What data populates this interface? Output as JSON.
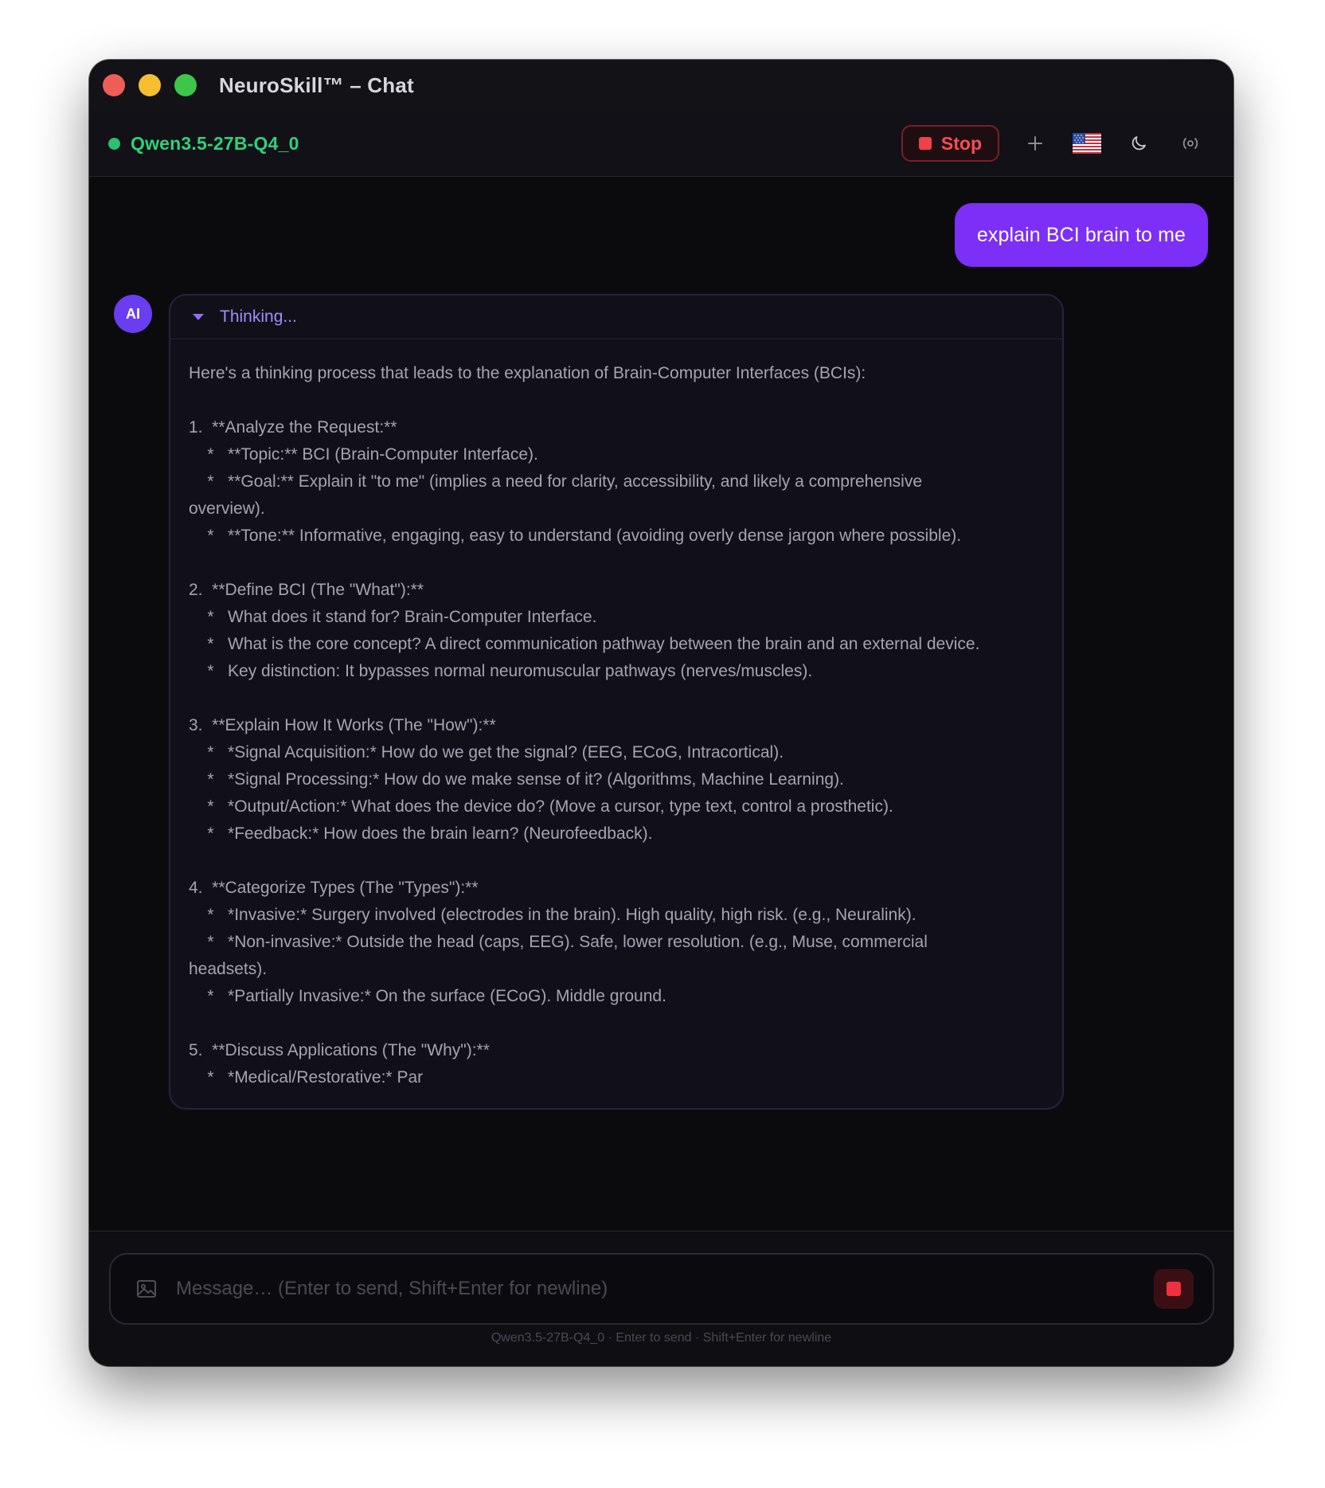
{
  "window": {
    "title": "NeuroSkill™ – Chat"
  },
  "toolbar": {
    "model_name": "Qwen3.5-27B-Q4_0",
    "stop_label": "Stop",
    "flag_icon": "us-flag-icon",
    "theme_icon": "moon-icon",
    "broadcast_icon": "broadcast-icon",
    "new_chat_icon": "plus-icon"
  },
  "chat": {
    "user_message": "explain BCI brain to me",
    "ai_avatar_label": "AI",
    "thinking_label": "Thinking...",
    "thinking_lines": [
      "Here's a thinking process that leads to the explanation of Brain-Computer Interfaces (BCIs):",
      "",
      "1.  **Analyze the Request:**",
      "    *   **Topic:** BCI (Brain-Computer Interface).",
      "    *   **Goal:** Explain it \"to me\" (implies a need for clarity, accessibility, and likely a comprehensive",
      "overview).",
      "    *   **Tone:** Informative, engaging, easy to understand (avoiding overly dense jargon where possible).",
      "",
      "2.  **Define BCI (The \"What\"):**",
      "    *   What does it stand for? Brain-Computer Interface.",
      "    *   What is the core concept? A direct communication pathway between the brain and an external device.",
      "    *   Key distinction: It bypasses normal neuromuscular pathways (nerves/muscles).",
      "",
      "3.  **Explain How It Works (The \"How\"):**",
      "    *   *Signal Acquisition:* How do we get the signal? (EEG, ECoG, Intracortical).",
      "    *   *Signal Processing:* How do we make sense of it? (Algorithms, Machine Learning).",
      "    *   *Output/Action:* What does the device do? (Move a cursor, type text, control a prosthetic).",
      "    *   *Feedback:* How does the brain learn? (Neurofeedback).",
      "",
      "4.  **Categorize Types (The \"Types\"):**",
      "    *   *Invasive:* Surgery involved (electrodes in the brain). High quality, high risk. (e.g., Neuralink).",
      "    *   *Non-invasive:* Outside the head (caps, EEG). Safe, lower resolution. (e.g., Muse, commercial",
      "headsets).",
      "    *   *Partially Invasive:* On the surface (ECoG). Middle ground.",
      "",
      "5.  **Discuss Applications (The \"Why\"):**",
      "    *   *Medical/Restorative:* Par"
    ]
  },
  "composer": {
    "placeholder": "Message… (Enter to send, Shift+Enter for newline)",
    "value": "",
    "hint": "Qwen3.5-27B-Q4_0 · Enter to send · Shift+Enter for newline"
  },
  "colors": {
    "accent_purple": "#7b2ff7",
    "status_green": "#2fd17b",
    "stop_red": "#ff4b55"
  }
}
